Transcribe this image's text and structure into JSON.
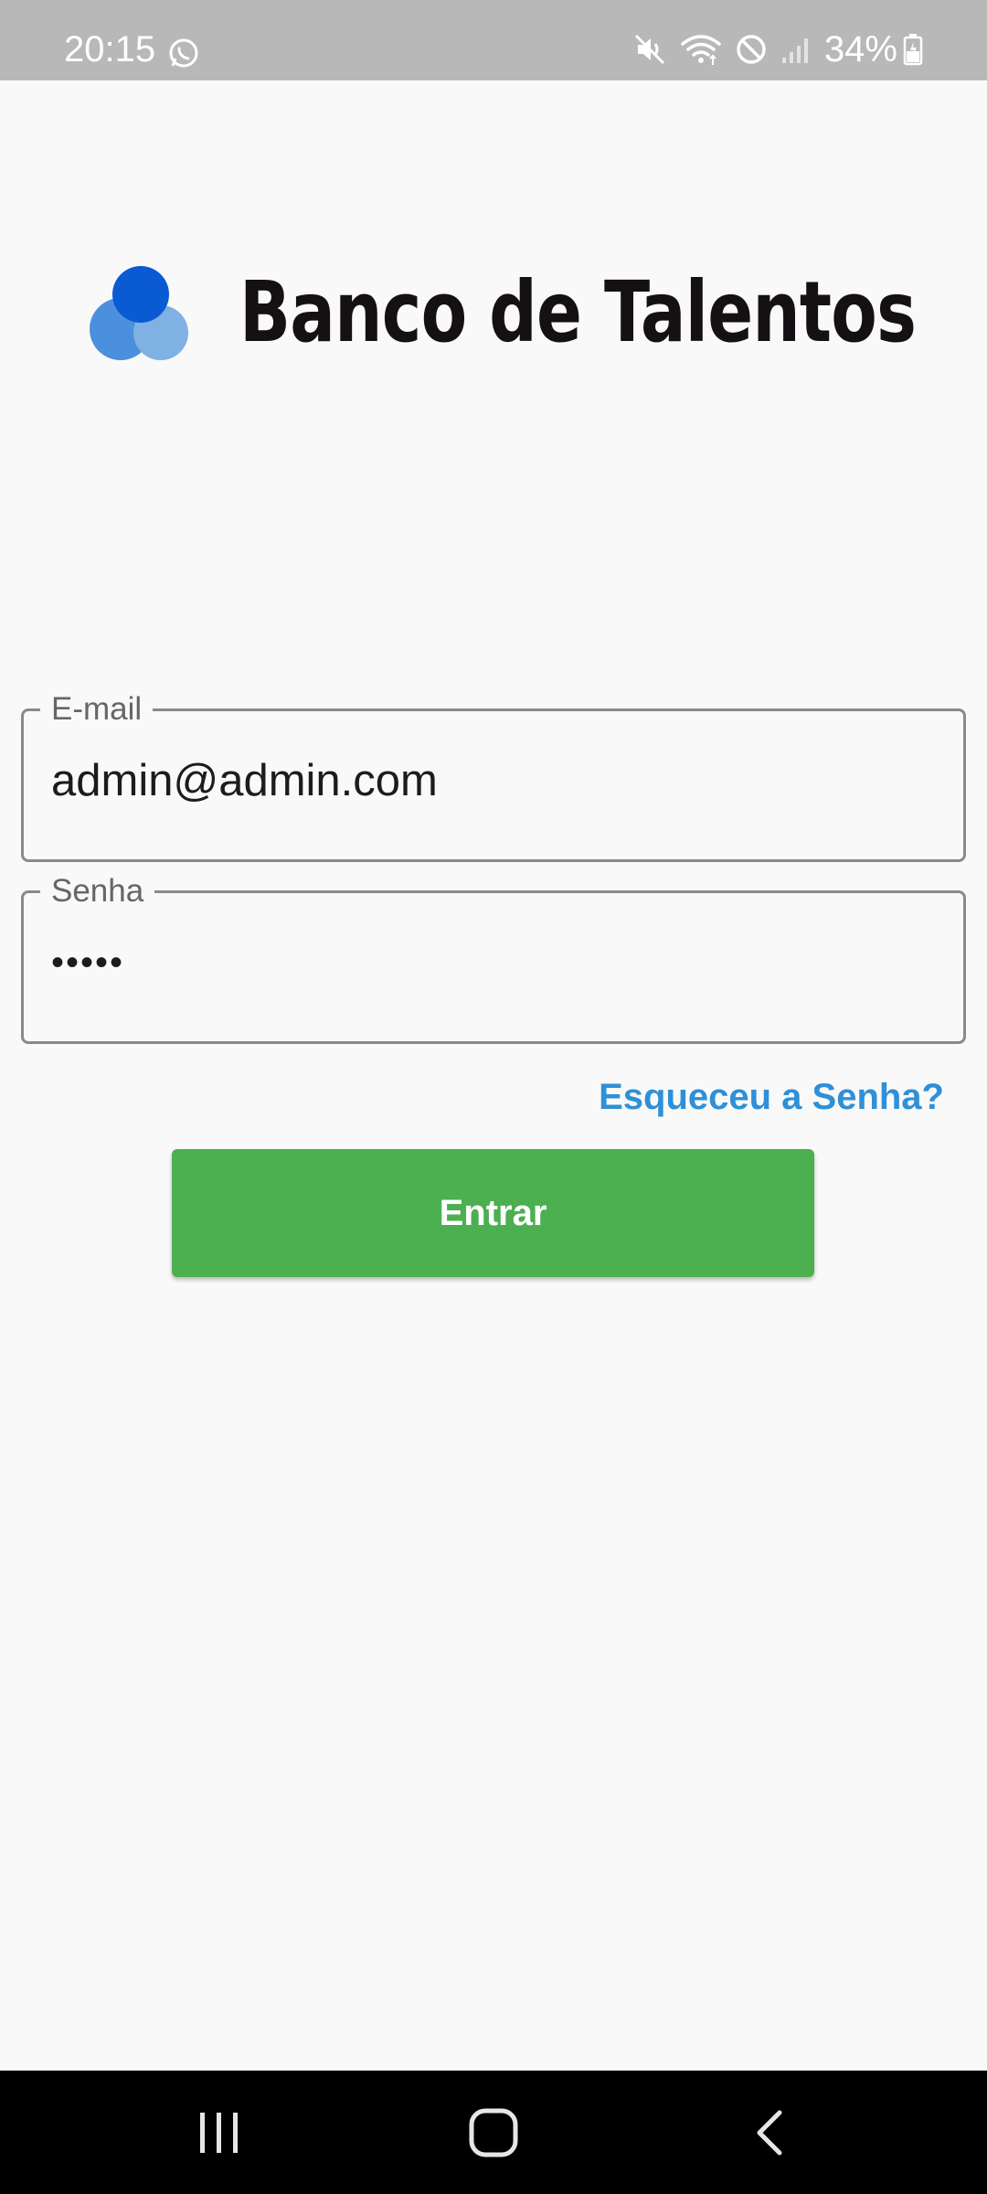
{
  "status_bar": {
    "time": "20:15",
    "battery": "34%",
    "icons": [
      "whatsapp-icon",
      "mute-icon",
      "wifi-icon",
      "do-not-disturb-icon",
      "signal-icon",
      "battery-icon"
    ]
  },
  "brand": {
    "title": "Banco de Talentos",
    "logo_colors": [
      "#0a5bd3",
      "#4a90dc",
      "#7fb1e3"
    ]
  },
  "login_form": {
    "email": {
      "label": "E-mail",
      "value": "admin@admin.com"
    },
    "password": {
      "label": "Senha",
      "value": "•••••"
    },
    "forgot_password": "Esqueceu a Senha?",
    "submit_label": "Entrar"
  },
  "colors": {
    "primary_button": "#4caf50",
    "link": "#2e90d8",
    "background": "#f9f9f9"
  },
  "nav_bar": {
    "buttons": [
      "recents-icon",
      "home-icon",
      "back-icon"
    ]
  }
}
